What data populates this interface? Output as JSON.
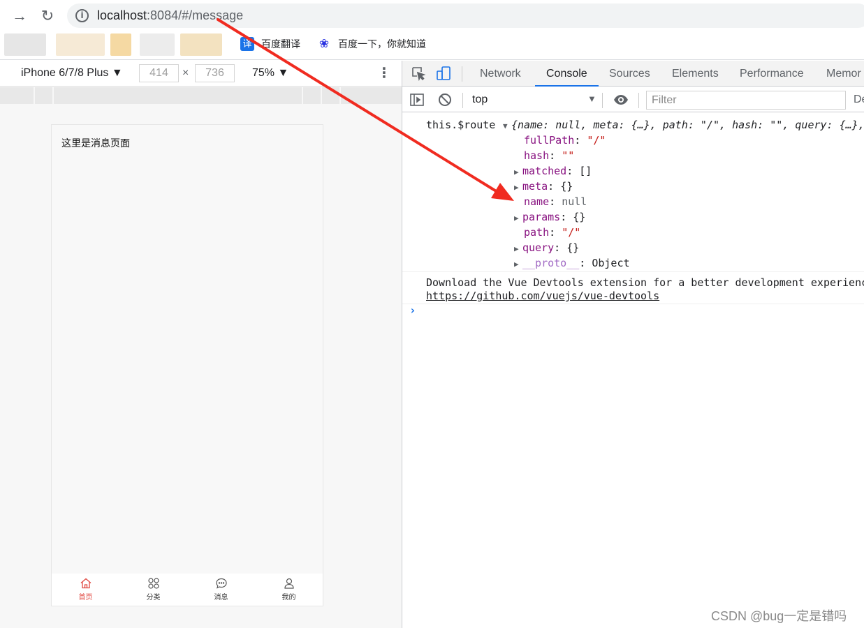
{
  "browser": {
    "url_host": "localhost",
    "url_path": ":8084/#/message",
    "bookmarks": [
      {
        "label": "百度翻译",
        "icon": "translate-icon",
        "glyph": "译",
        "color": "#1a73e8"
      },
      {
        "label": "百度一下，你就知道",
        "icon": "baidu-paw-icon",
        "glyph": "❀",
        "color": "#2932e1"
      }
    ]
  },
  "device_toolbar": {
    "device": "iPhone 6/7/8 Plus ▼",
    "width": "414",
    "times": "×",
    "height": "736",
    "zoom": "75% ▼"
  },
  "page": {
    "message_text": "这里是消息页面",
    "tabs": [
      {
        "label": "首页",
        "icon": "home-icon",
        "active": true
      },
      {
        "label": "分类",
        "icon": "category-icon",
        "active": false
      },
      {
        "label": "消息",
        "icon": "message-icon",
        "active": false
      },
      {
        "label": "我的",
        "icon": "profile-icon",
        "active": false
      }
    ]
  },
  "devtools": {
    "tabs": [
      "Network",
      "Console",
      "Sources",
      "Elements",
      "Performance",
      "Memor"
    ],
    "active_tab": "Console",
    "context": "top",
    "filter_placeholder": "Filter",
    "default_levels": "De",
    "console": {
      "route_label": "this.$route",
      "route_summary": "{name: null, meta: {…}, path: \"/\", hash: \"\", query: {…},",
      "props": [
        {
          "key": "fullPath",
          "value": "\"/\"",
          "expandable": false,
          "kind": "string"
        },
        {
          "key": "hash",
          "value": "\"\"",
          "expandable": false,
          "kind": "string"
        },
        {
          "key": "matched",
          "value": "[]",
          "expandable": true,
          "kind": "plain"
        },
        {
          "key": "meta",
          "value": "{}",
          "expandable": true,
          "kind": "plain"
        },
        {
          "key": "name",
          "value": "null",
          "expandable": false,
          "kind": "null"
        },
        {
          "key": "params",
          "value": "{}",
          "expandable": true,
          "kind": "plain"
        },
        {
          "key": "path",
          "value": "\"/\"",
          "expandable": false,
          "kind": "string"
        },
        {
          "key": "query",
          "value": "{}",
          "expandable": true,
          "kind": "plain"
        },
        {
          "key": "__proto__",
          "value": "Object",
          "expandable": true,
          "kind": "proto"
        }
      ],
      "vue_msg": "Download the Vue Devtools extension for a better development experienc",
      "vue_link": "https://github.com/vuejs/vue-devtools",
      "prompt": "›"
    }
  },
  "watermark": "CSDN @bug一定是错吗",
  "annotation": {
    "color": "#f02b20"
  }
}
